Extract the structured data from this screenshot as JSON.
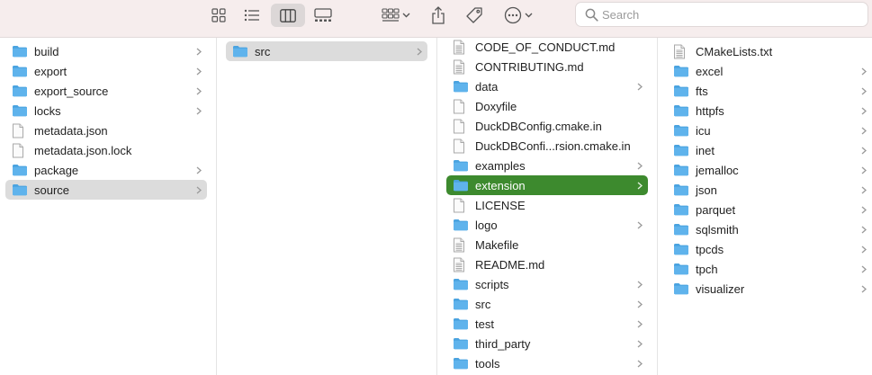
{
  "toolbar": {
    "search_placeholder": "Search",
    "icons": [
      "icon-view-grid-icon",
      "list-view-icon",
      "column-view-icon",
      "gallery-view-icon",
      "group-icon",
      "share-icon",
      "tag-icon",
      "more-actions-icon",
      "search-icon"
    ]
  },
  "columns": [
    {
      "items": [
        {
          "name": "build",
          "kind": "folder",
          "chevron": true,
          "selected": ""
        },
        {
          "name": "export",
          "kind": "folder",
          "chevron": true,
          "selected": ""
        },
        {
          "name": "export_source",
          "kind": "folder",
          "chevron": true,
          "selected": ""
        },
        {
          "name": "locks",
          "kind": "folder",
          "chevron": true,
          "selected": ""
        },
        {
          "name": "metadata.json",
          "kind": "file",
          "chevron": false,
          "selected": ""
        },
        {
          "name": "metadata.json.lock",
          "kind": "file",
          "chevron": false,
          "selected": ""
        },
        {
          "name": "package",
          "kind": "folder",
          "chevron": true,
          "selected": ""
        },
        {
          "name": "source",
          "kind": "folder",
          "chevron": true,
          "selected": "gray"
        }
      ]
    },
    {
      "items": [
        {
          "name": "src",
          "kind": "folder",
          "chevron": true,
          "selected": "gray"
        }
      ]
    },
    {
      "items": [
        {
          "name": "CODE_OF_CONDUCT.md",
          "kind": "doc",
          "chevron": false,
          "selected": ""
        },
        {
          "name": "CONTRIBUTING.md",
          "kind": "doc",
          "chevron": false,
          "selected": ""
        },
        {
          "name": "data",
          "kind": "folder",
          "chevron": true,
          "selected": ""
        },
        {
          "name": "Doxyfile",
          "kind": "file",
          "chevron": false,
          "selected": ""
        },
        {
          "name": "DuckDBConfig.cmake.in",
          "kind": "file",
          "chevron": false,
          "selected": ""
        },
        {
          "name": "DuckDBConfi...rsion.cmake.in",
          "kind": "file",
          "chevron": false,
          "selected": ""
        },
        {
          "name": "examples",
          "kind": "folder",
          "chevron": true,
          "selected": ""
        },
        {
          "name": "extension",
          "kind": "folder",
          "chevron": true,
          "selected": "green"
        },
        {
          "name": "LICENSE",
          "kind": "file",
          "chevron": false,
          "selected": ""
        },
        {
          "name": "logo",
          "kind": "folder",
          "chevron": true,
          "selected": ""
        },
        {
          "name": "Makefile",
          "kind": "doc",
          "chevron": false,
          "selected": ""
        },
        {
          "name": "README.md",
          "kind": "doc",
          "chevron": false,
          "selected": ""
        },
        {
          "name": "scripts",
          "kind": "folder",
          "chevron": true,
          "selected": ""
        },
        {
          "name": "src",
          "kind": "folder",
          "chevron": true,
          "selected": ""
        },
        {
          "name": "test",
          "kind": "folder",
          "chevron": true,
          "selected": ""
        },
        {
          "name": "third_party",
          "kind": "folder",
          "chevron": true,
          "selected": ""
        },
        {
          "name": "tools",
          "kind": "folder",
          "chevron": true,
          "selected": ""
        }
      ]
    },
    {
      "items": [
        {
          "name": "CMakeLists.txt",
          "kind": "doc",
          "chevron": false,
          "selected": ""
        },
        {
          "name": "excel",
          "kind": "folder",
          "chevron": true,
          "selected": ""
        },
        {
          "name": "fts",
          "kind": "folder",
          "chevron": true,
          "selected": ""
        },
        {
          "name": "httpfs",
          "kind": "folder",
          "chevron": true,
          "selected": ""
        },
        {
          "name": "icu",
          "kind": "folder",
          "chevron": true,
          "selected": ""
        },
        {
          "name": "inet",
          "kind": "folder",
          "chevron": true,
          "selected": ""
        },
        {
          "name": "jemalloc",
          "kind": "folder",
          "chevron": true,
          "selected": ""
        },
        {
          "name": "json",
          "kind": "folder",
          "chevron": true,
          "selected": ""
        },
        {
          "name": "parquet",
          "kind": "folder",
          "chevron": true,
          "selected": ""
        },
        {
          "name": "sqlsmith",
          "kind": "folder",
          "chevron": true,
          "selected": ""
        },
        {
          "name": "tpcds",
          "kind": "folder",
          "chevron": true,
          "selected": ""
        },
        {
          "name": "tpch",
          "kind": "folder",
          "chevron": true,
          "selected": ""
        },
        {
          "name": "visualizer",
          "kind": "folder",
          "chevron": true,
          "selected": ""
        }
      ]
    }
  ],
  "colors": {
    "folder_fill": "#5fb3ec",
    "folder_tab": "#4aa3e0",
    "selection_green": "#3d8a2e",
    "selection_gray": "#dcdcdc",
    "toolbar_bg": "#f6eded"
  }
}
